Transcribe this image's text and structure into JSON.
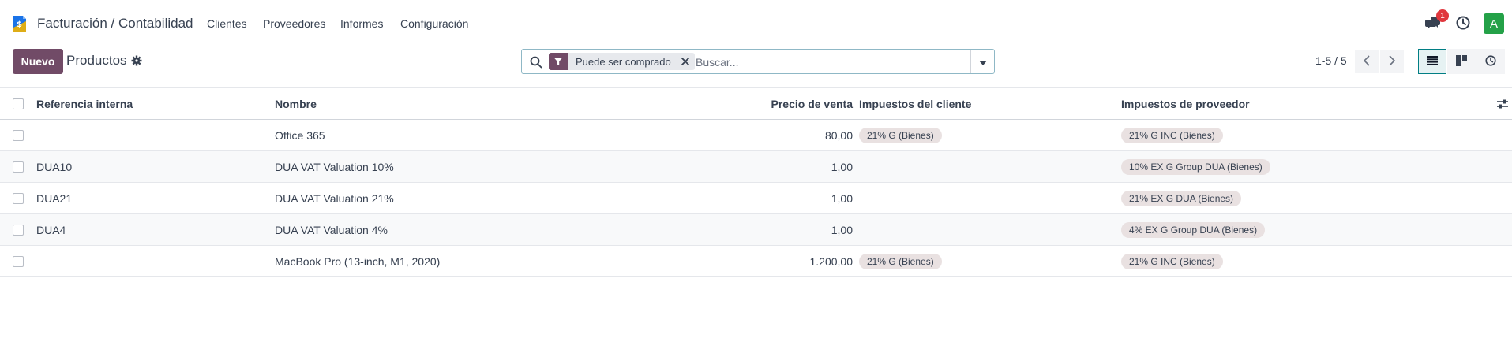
{
  "navbar": {
    "app_title": "Facturación / Contabilidad",
    "menu": [
      "Clientes",
      "Proveedores",
      "Informes",
      "Configuración"
    ],
    "messages_badge": "1",
    "avatar_letter": "A"
  },
  "control": {
    "new_label": "Nuevo",
    "breadcrumb": "Productos",
    "facet_label": "Puede ser comprado",
    "search_placeholder": "Buscar...",
    "pager": "1-5 / 5"
  },
  "table": {
    "headers": {
      "ref": "Referencia interna",
      "name": "Nombre",
      "price": "Precio de venta",
      "customer_taxes": "Impuestos del cliente",
      "vendor_taxes": "Impuestos de proveedor"
    },
    "rows": [
      {
        "ref": "",
        "name": "Office 365",
        "price": "80,00",
        "customer_taxes": "21% G (Bienes)",
        "vendor_taxes": "21% G INC (Bienes)"
      },
      {
        "ref": "DUA10",
        "name": "DUA VAT Valuation 10%",
        "price": "1,00",
        "customer_taxes": "",
        "vendor_taxes": "10% EX G Group DUA (Bienes)"
      },
      {
        "ref": "DUA21",
        "name": "DUA VAT Valuation 21%",
        "price": "1,00",
        "customer_taxes": "",
        "vendor_taxes": "21% EX G DUA (Bienes)"
      },
      {
        "ref": "DUA4",
        "name": "DUA VAT Valuation 4%",
        "price": "1,00",
        "customer_taxes": "",
        "vendor_taxes": "4% EX G Group DUA (Bienes)"
      },
      {
        "ref": "",
        "name": "MacBook Pro (13-inch, M1, 2020)",
        "price": "1.200,00",
        "customer_taxes": "21% G (Bienes)",
        "vendor_taxes": "21% G INC (Bienes)"
      }
    ]
  },
  "colors": {
    "brand": "#714b67",
    "accent": "#017e84",
    "badge": "#e0373d",
    "avatar": "#24a148",
    "tag_bg": "#e9e1e1"
  }
}
